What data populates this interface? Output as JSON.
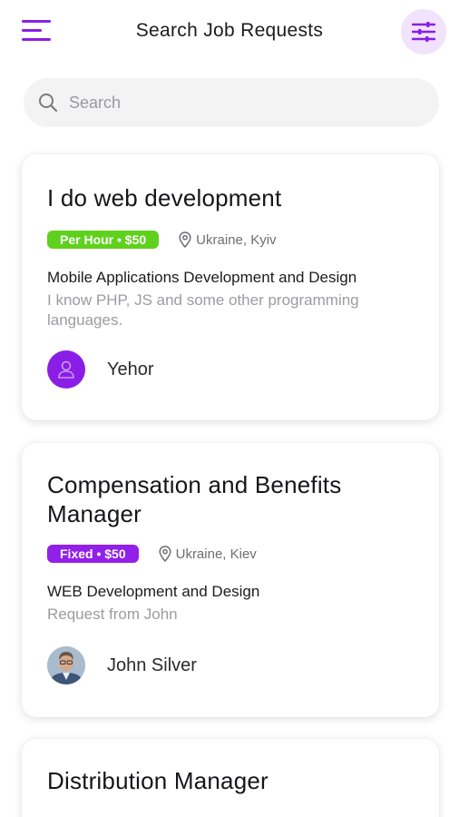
{
  "header": {
    "title": "Search Job Requests",
    "menu_icon": "hamburger-menu-icon",
    "filter_icon": "sliders-filter-icon"
  },
  "search": {
    "placeholder": "Search",
    "value": ""
  },
  "colors": {
    "accent": "#8a1ee6",
    "badge_green": "#5fd11c",
    "badge_purple": "#9220e8",
    "filter_bg": "#f1e3fb"
  },
  "cards": [
    {
      "title": "I do web development",
      "badge": "Per Hour • $50",
      "badge_color": "#5fd11c",
      "location": "Ukraine, Kyiv",
      "subject": "Mobile Applications Development and Design",
      "description": "I know PHP, JS and some other programming languages.",
      "author": "Yehor",
      "avatar": "user-placeholder-icon"
    },
    {
      "title": "Compensation and Benefits Manager",
      "badge": "Fixed • $50",
      "badge_color": "#9220e8",
      "location": "Ukraine, Kiev",
      "subject": "WEB Development and Design",
      "description": "Request from John",
      "author": "John Silver",
      "avatar": "user-photo"
    },
    {
      "title": "Distribution Manager"
    }
  ]
}
